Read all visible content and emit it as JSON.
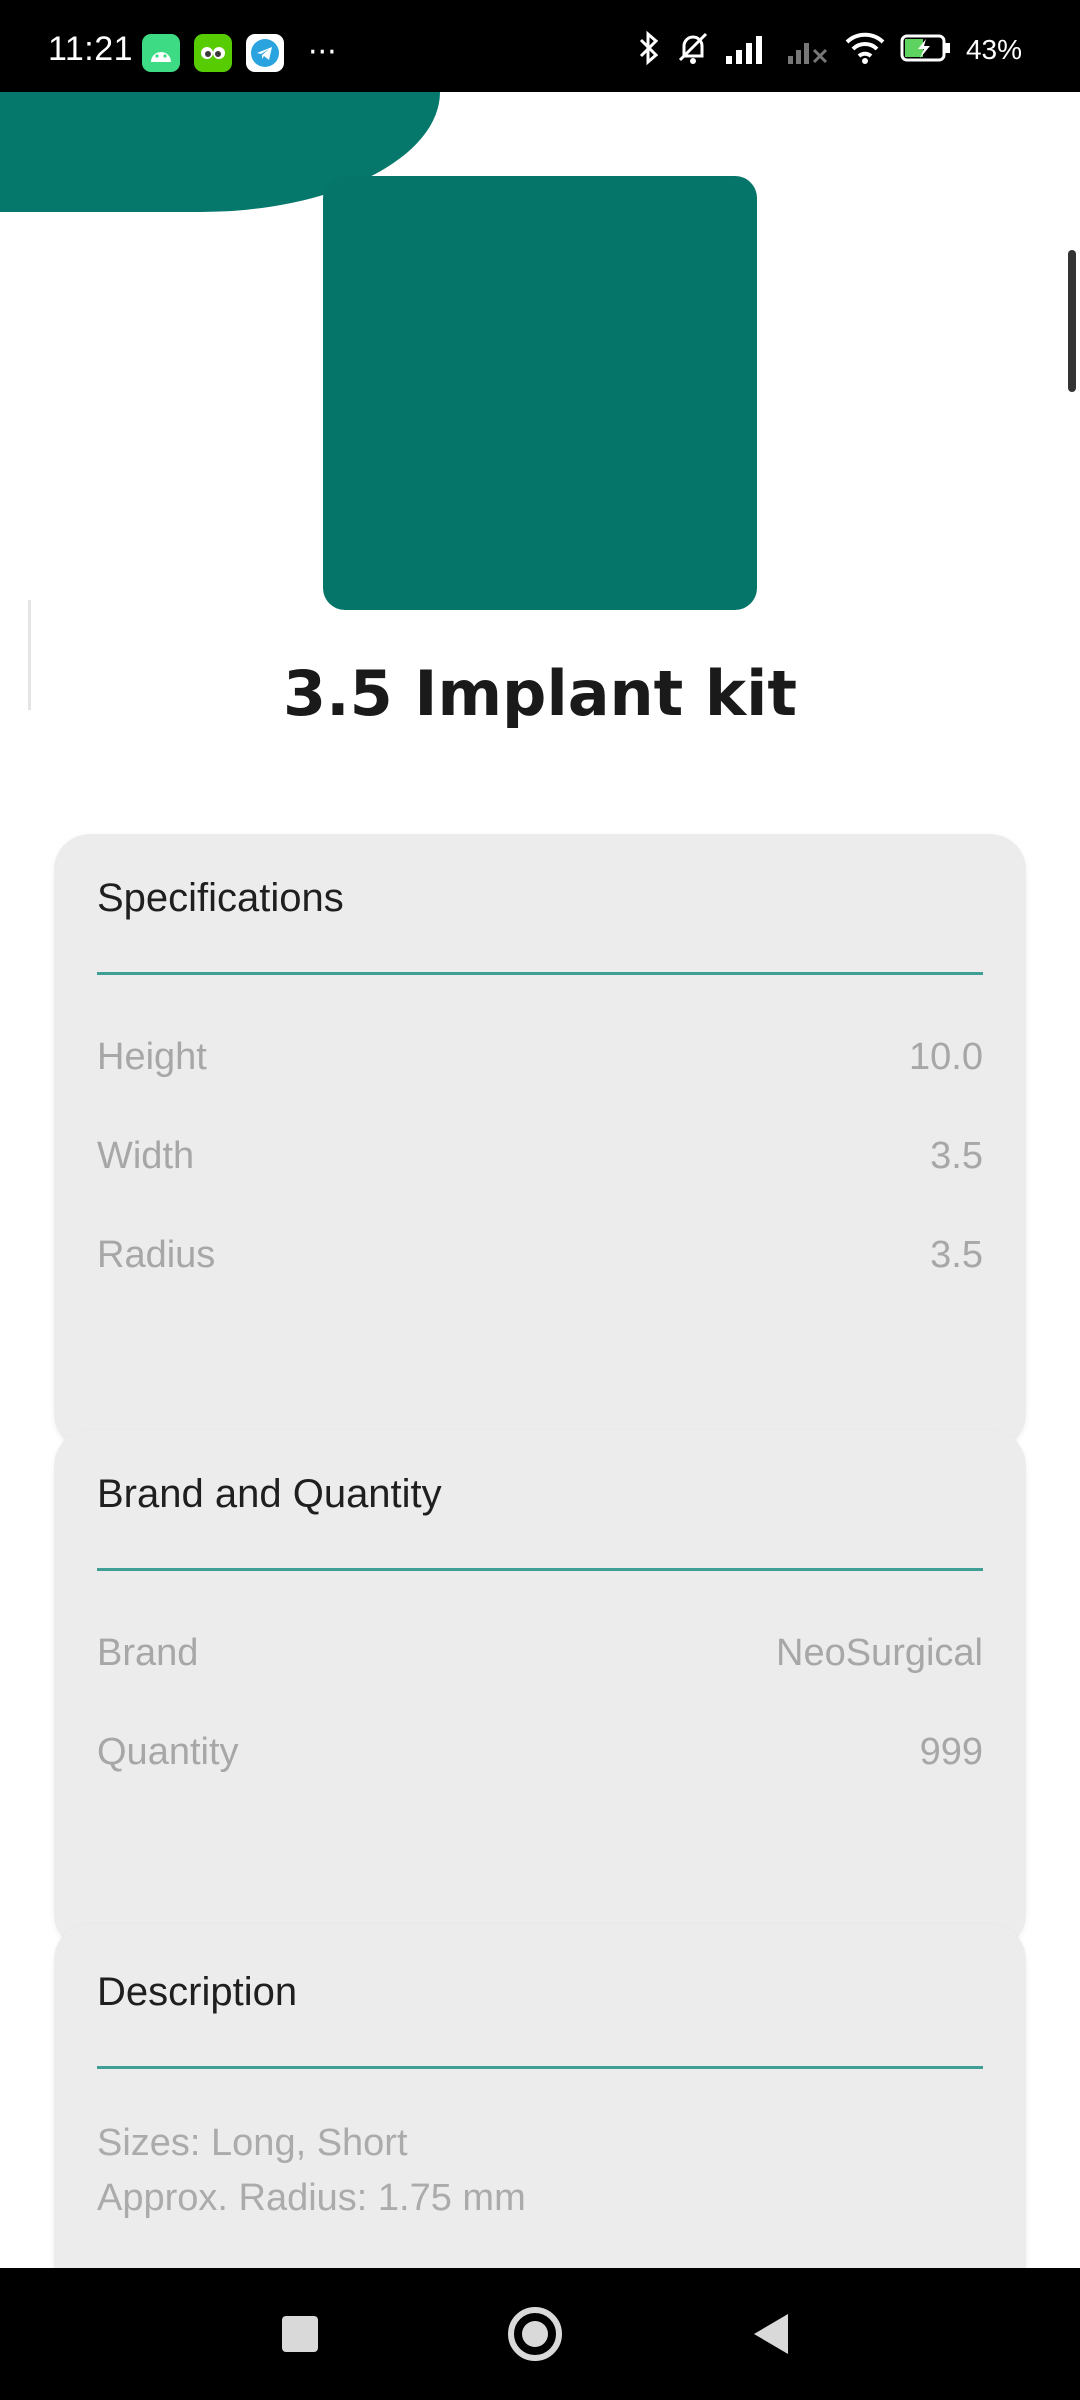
{
  "status_bar": {
    "time": "11:21",
    "battery": "43%",
    "app_icons": [
      "android-icon",
      "duolingo-icon",
      "telegram-icon"
    ],
    "more": "···"
  },
  "product": {
    "title": "3.5 Implant kit",
    "image_color": "#05756a"
  },
  "specifications": {
    "title": "Specifications",
    "rows": [
      {
        "label": "Height",
        "value": "10.0"
      },
      {
        "label": "Width",
        "value": "3.5"
      },
      {
        "label": "Radius",
        "value": "3.5"
      }
    ]
  },
  "brand_quantity": {
    "title": "Brand and Quantity",
    "rows": [
      {
        "label": "Brand",
        "value": "NeoSurgical"
      },
      {
        "label": "Quantity",
        "value": "999"
      }
    ]
  },
  "description": {
    "title": "Description",
    "lines": [
      "Sizes: Long, Short",
      "Approx. Radius: 1.75 mm"
    ]
  },
  "colors": {
    "accent": "#05776b",
    "divider": "#3f9f95",
    "card_bg": "#ececec"
  }
}
